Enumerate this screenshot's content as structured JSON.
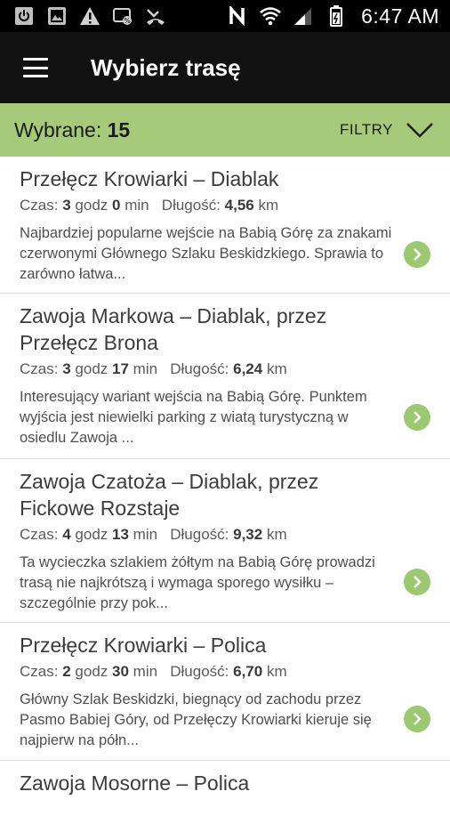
{
  "status_bar": {
    "time": "6:47 AM",
    "icons": [
      "power-icon",
      "image-icon",
      "warning-icon",
      "data-saver-icon",
      "missed-call-icon",
      "nfc-icon",
      "wifi-icon",
      "signal-icon",
      "battery-icon"
    ]
  },
  "app_bar": {
    "title": "Wybierz trasę",
    "menu_icon": "hamburger-menu-icon"
  },
  "filter_bar": {
    "selected_label": "Wybrane:",
    "selected_count": "15",
    "filters_label": "FILTRY"
  },
  "labels": {
    "time": "Czas:",
    "hours": "godz",
    "minutes": "min",
    "length": "Długość:",
    "km": "km"
  },
  "colors": {
    "accent_green": "#a5ca7a",
    "app_bar": "#111111",
    "arrow_button": "#9bc870"
  },
  "routes": [
    {
      "title": "Przełęcz Krowiarki – Diablak",
      "hours": "3",
      "minutes": "0",
      "length": "4,56",
      "description": "Najbardziej popularne wejście na Babią Górę za znakami czerwonymi Głównego Szlaku Beskidzkiego. Sprawia to zarówno łatwa..."
    },
    {
      "title": "Zawoja Markowa – Diablak, przez Przełęcz Brona",
      "hours": "3",
      "minutes": "17",
      "length": "6,24",
      "description": "Interesujący wariant wejścia na Babią Górę. Punktem wyjścia jest niewielki parking z wiatą turystyczną w osiedlu Zawoja ..."
    },
    {
      "title": "Zawoja Czatoża – Diablak, przez Fickowe Rozstaje",
      "hours": "4",
      "minutes": "13",
      "length": "9,32",
      "description": "Ta wycieczka szlakiem żółtym na Babią Górę prowadzi trasą nie najkrótszą i wymaga sporego wysiłku – szczególnie przy pok..."
    },
    {
      "title": "Przełęcz Krowiarki – Polica",
      "hours": "2",
      "minutes": "30",
      "length": "6,70",
      "description": "Główny Szlak Beskidzki, biegnący od zachodu przez Pasmo Babiej Góry, od Przełęczy Krowiarki kieruje się najpierw na półn..."
    },
    {
      "title": "Zawoja Mosorne – Polica"
    }
  ]
}
